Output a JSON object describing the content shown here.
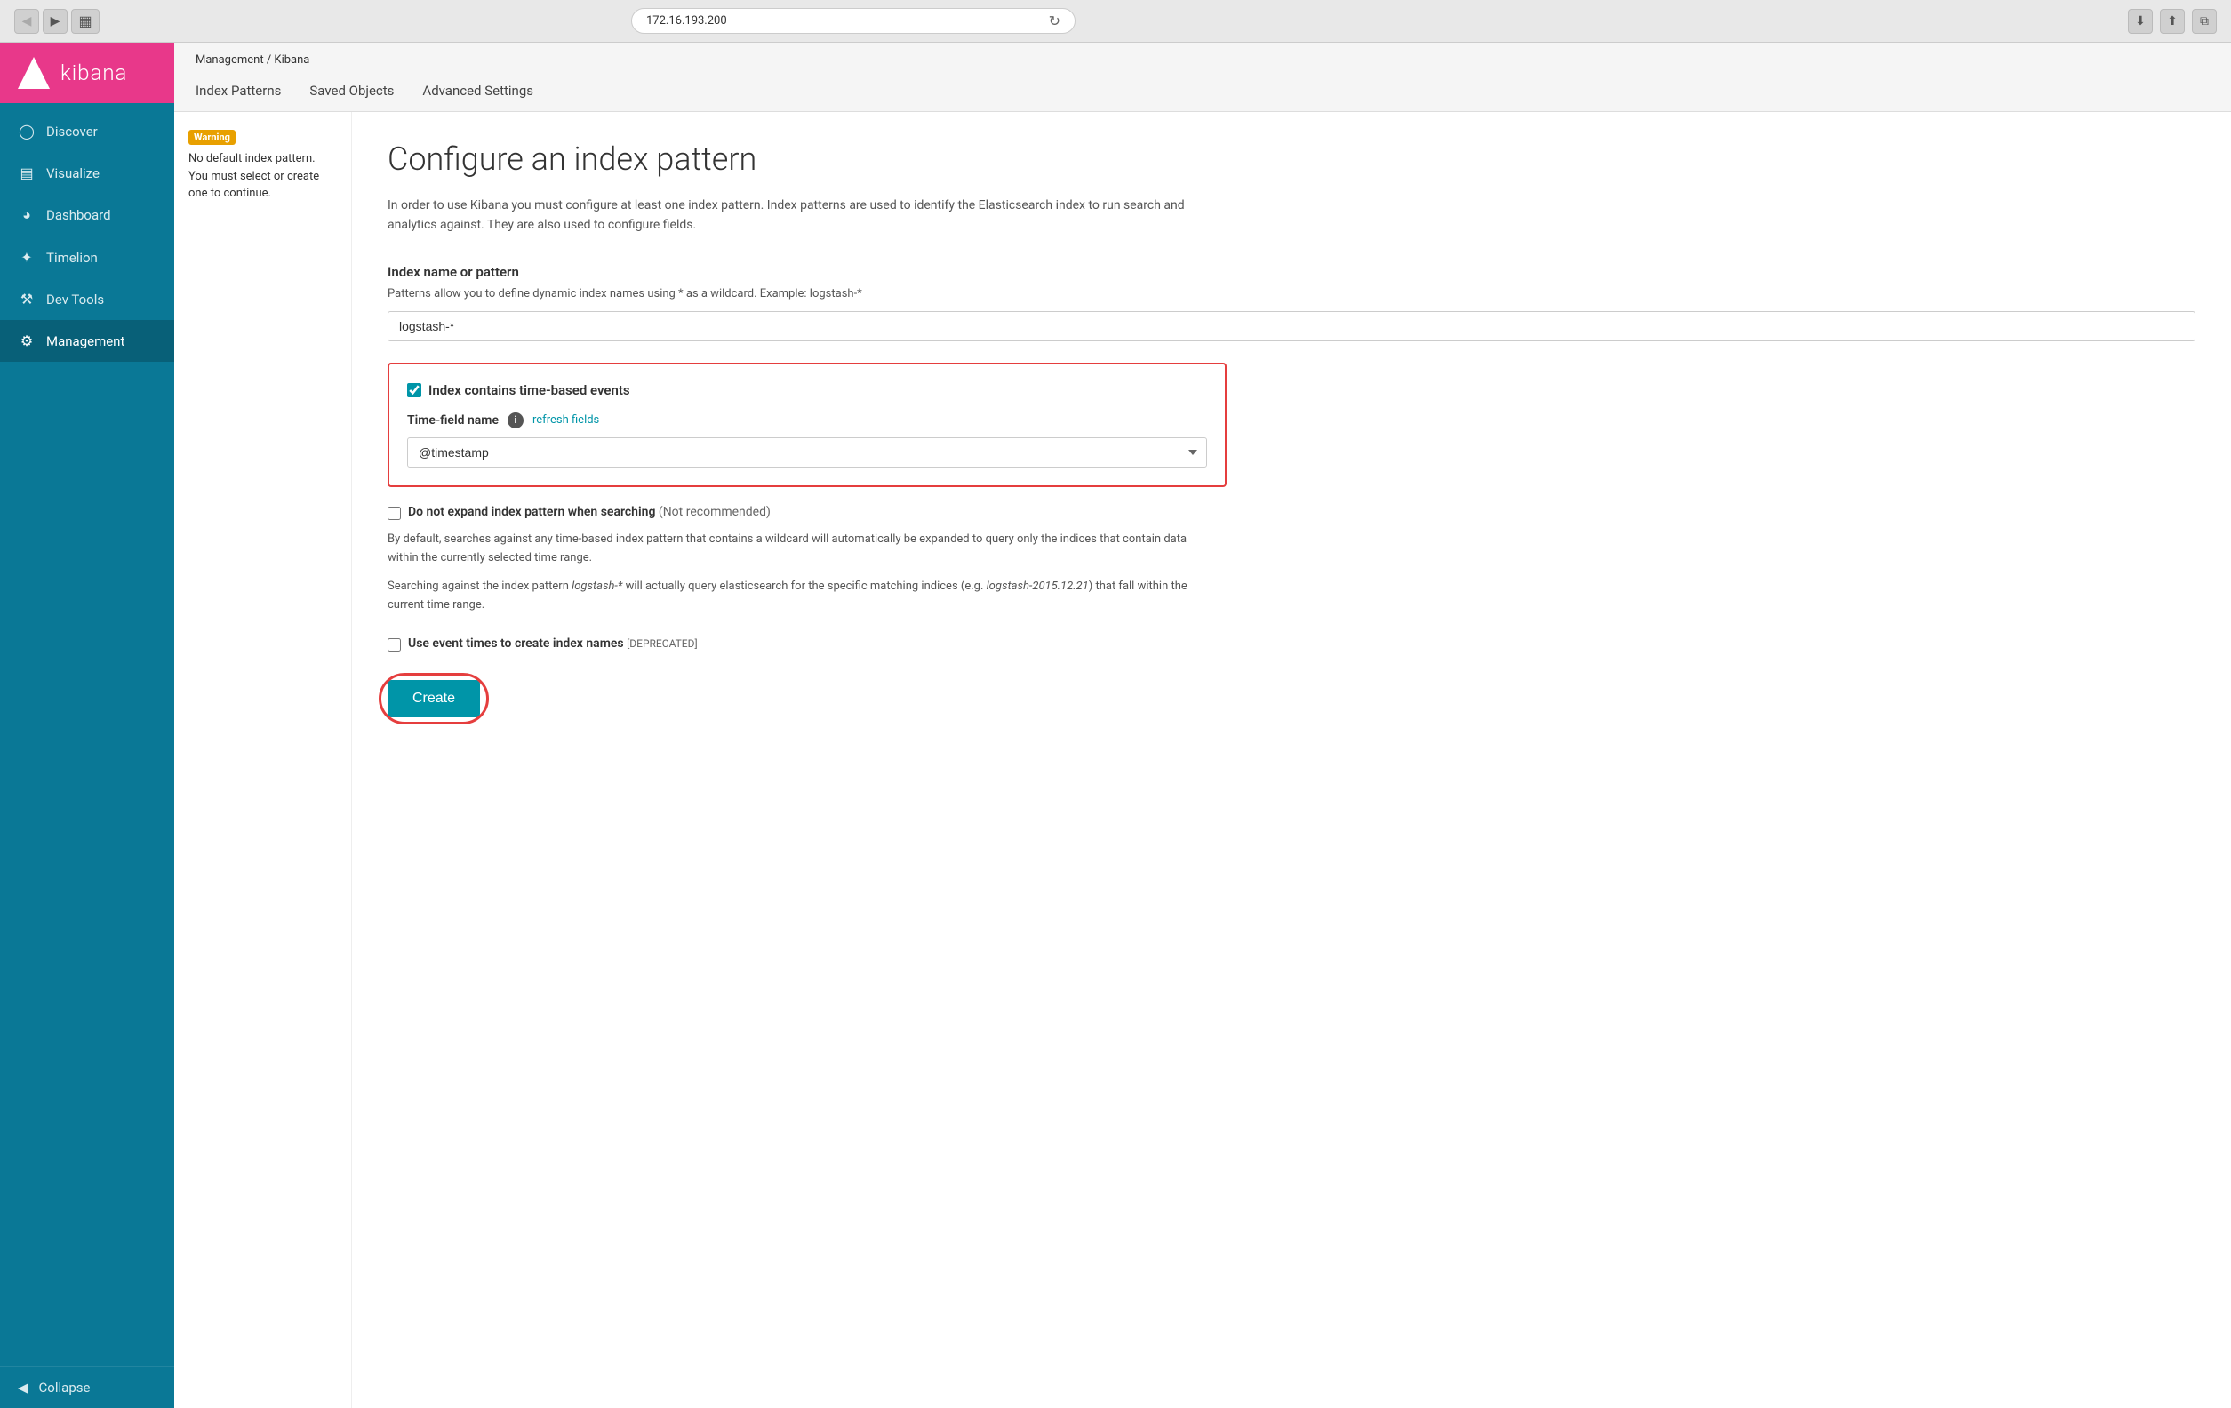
{
  "browser": {
    "url": "172.16.193.200",
    "back_btn": "◀",
    "forward_btn": "▶",
    "sidebar_btn": "⊞",
    "refresh_btn": "↻",
    "download_btn": "⬇",
    "share_btn": "⬆",
    "expand_btn": "⧉"
  },
  "sidebar": {
    "logo_text": "kibana",
    "nav_items": [
      {
        "id": "discover",
        "label": "Discover",
        "icon": "◎"
      },
      {
        "id": "visualize",
        "label": "Visualize",
        "icon": "📊"
      },
      {
        "id": "dashboard",
        "label": "Dashboard",
        "icon": "◔"
      },
      {
        "id": "timelion",
        "label": "Timelion",
        "icon": "✱"
      },
      {
        "id": "devtools",
        "label": "Dev Tools",
        "icon": "🔧"
      },
      {
        "id": "management",
        "label": "Management",
        "icon": "⚙"
      }
    ],
    "collapse_label": "Collapse"
  },
  "top_nav": {
    "breadcrumb": "Management / Kibana",
    "breadcrumb_parts": [
      "Management",
      "Kibana"
    ],
    "tabs": [
      {
        "id": "index-patterns",
        "label": "Index Patterns"
      },
      {
        "id": "saved-objects",
        "label": "Saved Objects"
      },
      {
        "id": "advanced-settings",
        "label": "Advanced Settings"
      }
    ]
  },
  "warning": {
    "badge": "Warning",
    "text": "No default index pattern. You must select or create one to continue."
  },
  "form": {
    "page_title": "Configure an index pattern",
    "page_desc": "In order to use Kibana you must configure at least one index pattern. Index patterns are used to identify the Elasticsearch index to run search and analytics against. They are also used to configure fields.",
    "index_name_section": {
      "title": "Index name or pattern",
      "desc": "Patterns allow you to define dynamic index names using * as a wildcard. Example: logstash-*",
      "input_value": "logstash-*",
      "input_placeholder": "logstash-*"
    },
    "time_events": {
      "checkbox_label": "Index contains time-based events",
      "checked": true,
      "time_field_label": "Time-field name",
      "refresh_link": "refresh fields",
      "select_value": "@timestamp"
    },
    "do_not_expand": {
      "checkbox_label": "Do not expand index pattern when searching",
      "not_recommended": "(Not recommended)",
      "checked": false,
      "desc1": "By default, searches against any time-based index pattern that contains a wildcard will automatically be expanded to query only the indices that contain data within the currently selected time range.",
      "desc2_start": "Searching against the index pattern ",
      "desc2_italic1": "logstash-*",
      "desc2_mid": " will actually query elasticsearch for the specific matching indices (e.g. ",
      "desc2_italic2": "logstash-2015.12.21",
      "desc2_end": ") that fall within the current time range."
    },
    "use_event_times": {
      "checkbox_label": "Use event times to create index names",
      "deprecated": "[DEPRECATED]",
      "checked": false
    },
    "create_btn_label": "Create"
  }
}
